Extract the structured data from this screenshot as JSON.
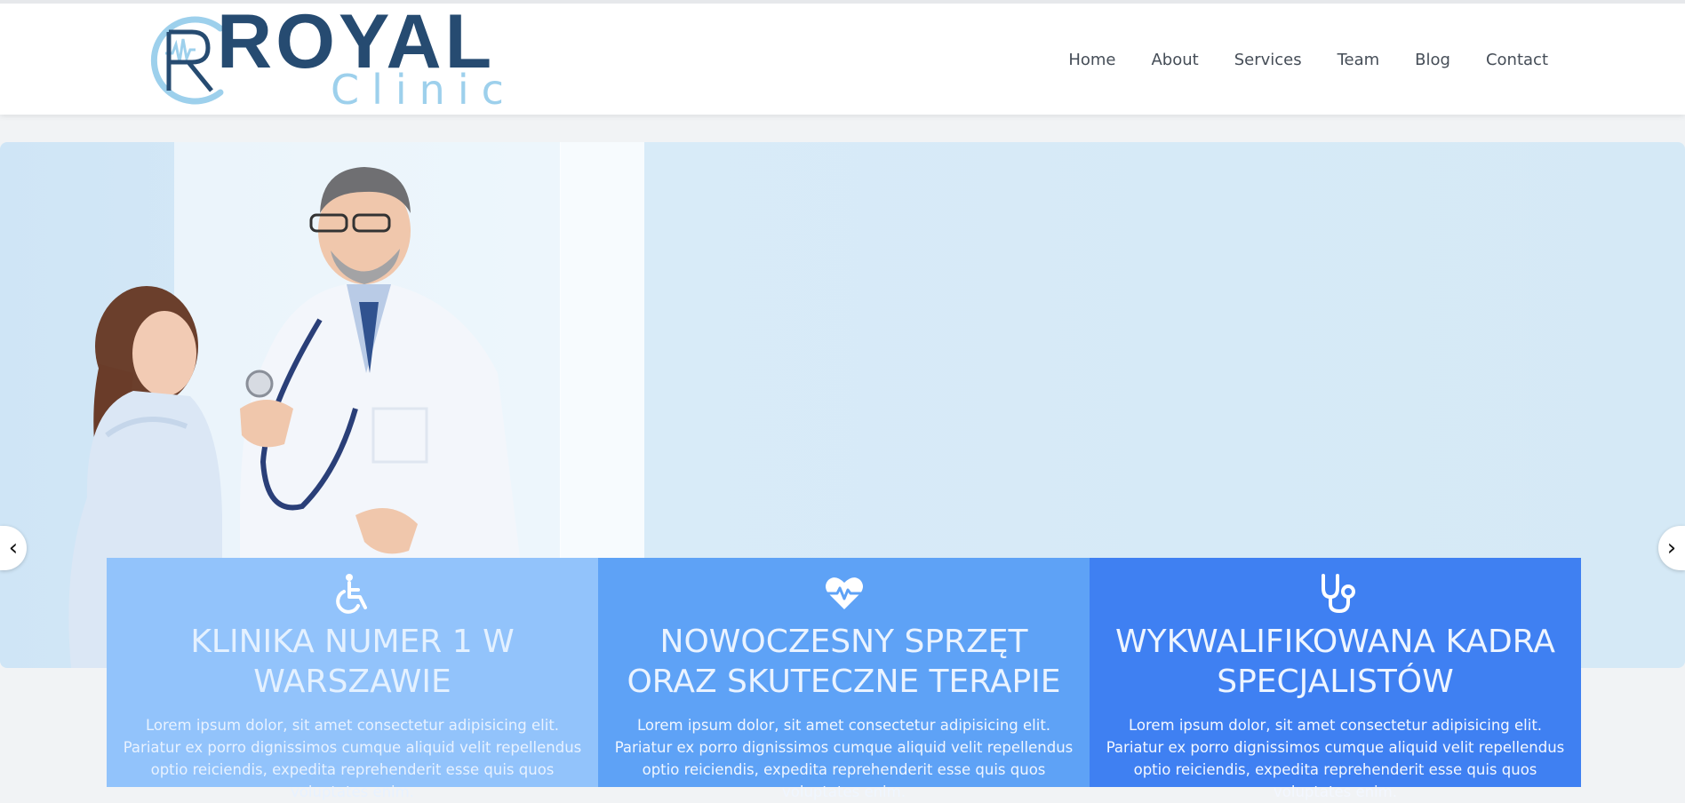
{
  "logo": {
    "royal": "ROYAL",
    "clinic": "Clinic",
    "monogram": "R"
  },
  "nav": {
    "items": [
      {
        "label": "Home"
      },
      {
        "label": "About"
      },
      {
        "label": "Services"
      },
      {
        "label": "Team"
      },
      {
        "label": "Blog"
      },
      {
        "label": "Contact"
      }
    ]
  },
  "carousel": {
    "prev_label": "‹",
    "next_label": "›"
  },
  "features": [
    {
      "icon": "wheelchair-icon",
      "title": "KLINIKA NUMER 1 W WARSZAWIE",
      "text": "Lorem ipsum dolor, sit amet consectetur adipisicing elit. Pariatur ex porro dignissimos cumque aliquid velit repellendus optio reiciendis, expedita reprehenderit esse quis quos voluptates enim."
    },
    {
      "icon": "heartbeat-icon",
      "title": "NOWOCZESNY SPRZĘT ORAZ SKUTECZNE TERAPIE",
      "text": "Lorem ipsum dolor, sit amet consectetur adipisicing elit. Pariatur ex porro dignissimos cumque aliquid velit repellendus optio reiciendis, expedita reprehenderit esse quis quos voluptates enim."
    },
    {
      "icon": "stethoscope-icon",
      "title": "WYKWALIFIKOWANA KADRA SPECJALISTÓW",
      "text": "Lorem ipsum dolor, sit amet consectetur adipisicing elit. Pariatur ex porro dignissimos cumque aliquid velit repellendus optio reiciendis, expedita reprehenderit esse quis quos voluptates enim."
    }
  ],
  "colors": {
    "brand_dark": "#264b71",
    "brand_light": "#9dd0ec",
    "feature_1": "#92c3fb",
    "feature_2": "#5ea2f6",
    "feature_3": "#3f80f2"
  }
}
